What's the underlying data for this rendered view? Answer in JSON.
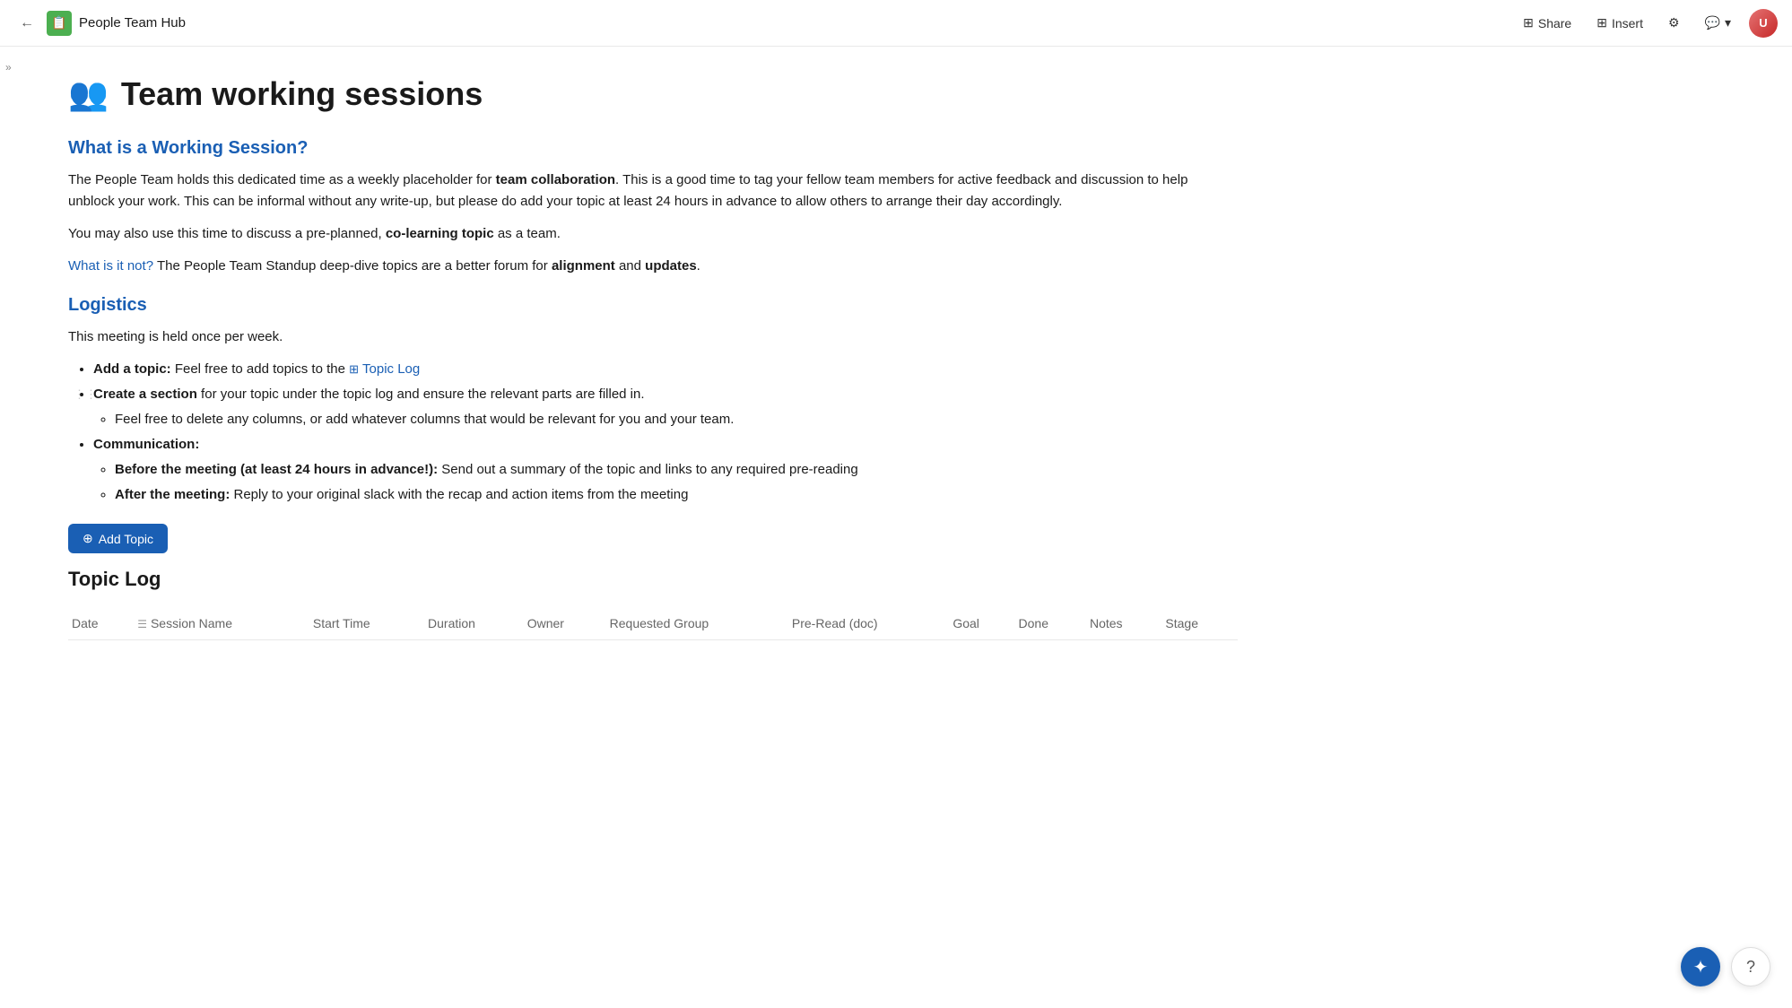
{
  "topnav": {
    "back_icon": "←",
    "app_icon": "📋",
    "app_title": "People Team Hub",
    "share_label": "Share",
    "insert_label": "Insert",
    "settings_icon": "⚙",
    "comment_icon": "💬",
    "chevron_icon": "▾",
    "avatar_initials": "U"
  },
  "sidebar": {
    "toggle_icon": "»"
  },
  "page": {
    "emoji": "👥",
    "title": "Team working sessions"
  },
  "sections": {
    "what_is": {
      "heading": "What is a Working Session?",
      "paragraph1_pre": "The People Team holds this dedicated time as a weekly placeholder for ",
      "paragraph1_bold": "team collaboration",
      "paragraph1_post": ". This is a good time to tag your fellow team members for active feedback and discussion to help unblock your work. This can be informal without any write-up, but please do add your topic at least 24 hours in advance to allow others to arrange their day accordingly.",
      "paragraph2_pre": "You may also use this time to discuss a pre-planned, ",
      "paragraph2_bold": "co-learning topic",
      "paragraph2_post": " as a team.",
      "paragraph3_link": "What is it not?",
      "paragraph3_post_pre": " The People Team Standup deep-dive topics are a better forum for ",
      "paragraph3_bold1": "alignment",
      "paragraph3_post_mid": " and ",
      "paragraph3_bold2": "updates",
      "paragraph3_end": "."
    },
    "logistics": {
      "heading": "Logistics",
      "intro": "This meeting is held once per week.",
      "bullet1_bold": "Add a topic:",
      "bullet1_pre": " Feel free to add topics to the ",
      "bullet1_link": "Topic Log",
      "bullet2_bold": "Create a section",
      "bullet2_post": " for your topic under the topic log and ensure the relevant parts are filled in.",
      "sub_bullet1": "Feel free to delete any columns, or add whatever columns that would be relevant for you and your team.",
      "bullet3_bold": "Communication:",
      "sub_bullet2_bold": "Before the meeting (at least 24 hours in advance!):",
      "sub_bullet2_post": " Send out a summary of the topic and links to any required pre-reading",
      "sub_bullet3_bold": "After the meeting:",
      "sub_bullet3_post": " Reply to your original slack with the recap and action items from the meeting"
    }
  },
  "topic_log": {
    "add_btn": "Add Topic",
    "heading": "Topic Log",
    "columns": [
      {
        "label": "Date",
        "icon": ""
      },
      {
        "label": "Session Name",
        "icon": "☰"
      },
      {
        "label": "Start Time",
        "icon": ""
      },
      {
        "label": "Duration",
        "icon": ""
      },
      {
        "label": "Owner",
        "icon": ""
      },
      {
        "label": "Requested Group",
        "icon": ""
      },
      {
        "label": "Pre-Read (doc)",
        "icon": ""
      },
      {
        "label": "Goal",
        "icon": ""
      },
      {
        "label": "Done",
        "icon": ""
      },
      {
        "label": "Notes",
        "icon": ""
      },
      {
        "label": "Stage",
        "icon": ""
      }
    ]
  },
  "float_bar": {
    "sparkle_icon": "✦",
    "help_icon": "?"
  }
}
